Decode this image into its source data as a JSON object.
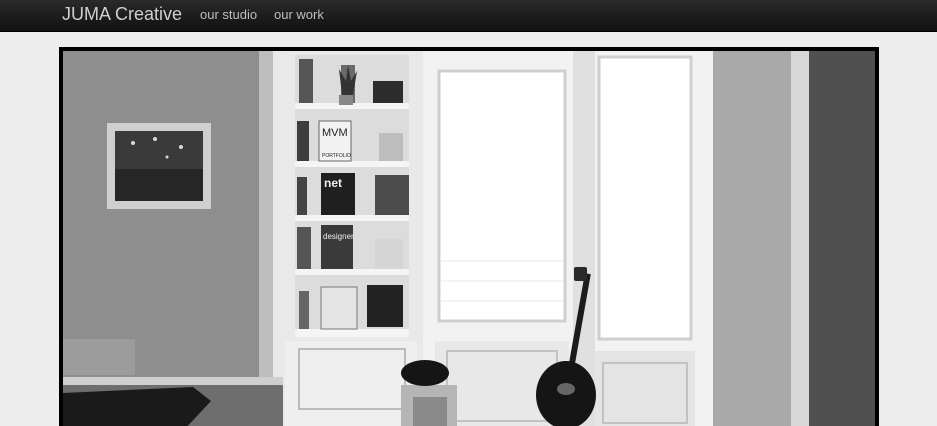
{
  "navbar": {
    "brand": "JUMA Creative",
    "links": [
      {
        "label": "our studio"
      },
      {
        "label": "our work"
      }
    ]
  },
  "hero": {
    "magazines": {
      "mag1": "MVM",
      "mag1b": "PORTFOLIO",
      "mag2": "net",
      "mag3": "designer"
    }
  },
  "colors": {
    "navbar_bg": "#1a1a1a",
    "page_bg": "#ededed",
    "frame": "#000000"
  }
}
